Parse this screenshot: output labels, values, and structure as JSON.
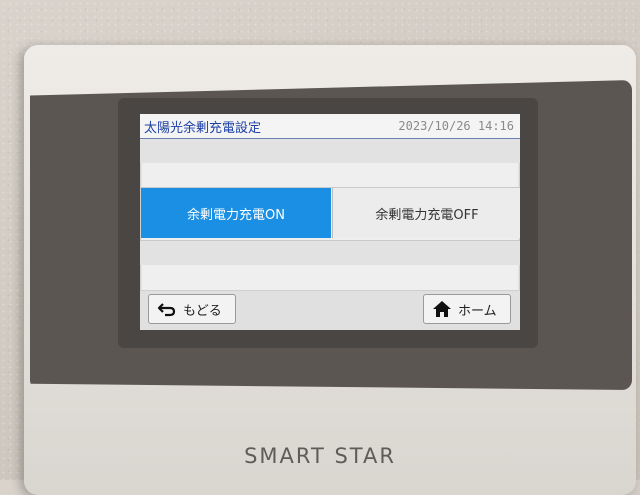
{
  "screen": {
    "title": "太陽光余剰充電設定",
    "datetime": "2023/10/26 14:16"
  },
  "options": {
    "on_label": "余剰電力充電ON",
    "off_label": "余剰電力充電OFF",
    "selected": "on"
  },
  "footer": {
    "back_label": "もどる",
    "home_label": "ホーム"
  },
  "device": {
    "brand": "SMART STAR"
  },
  "colors": {
    "accent": "#1a8fe3",
    "title_text": "#1d3fa5"
  },
  "icons": {
    "back": "return-arrow-icon",
    "home": "home-icon"
  }
}
